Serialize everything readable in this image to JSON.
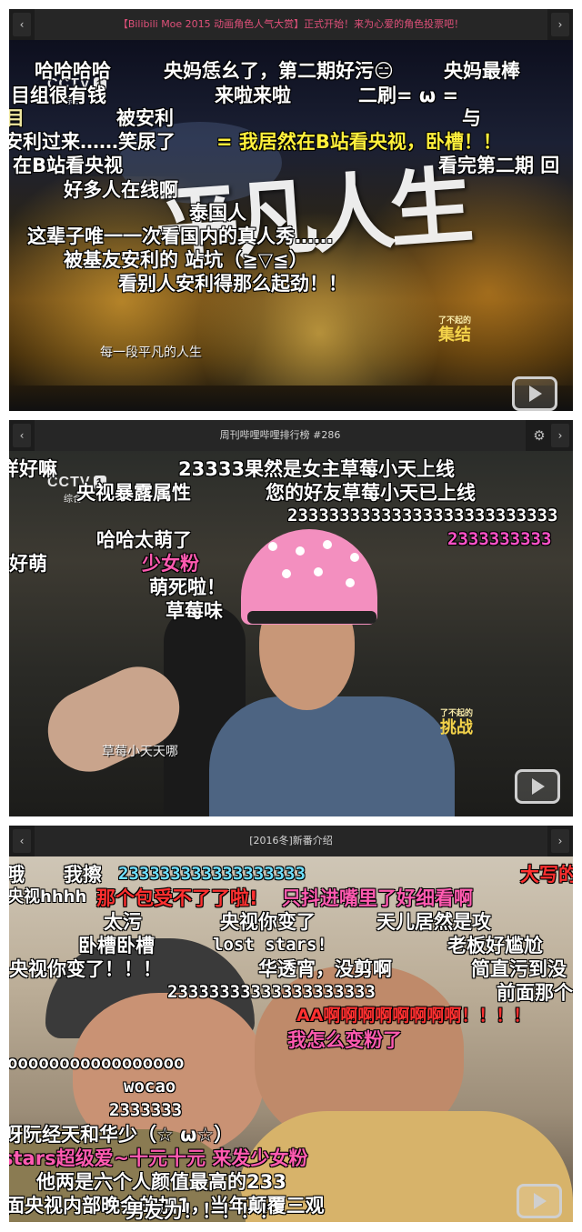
{
  "panels": [
    {
      "title": "【Bilibili Moe 2015 动画角色人气大赏】正式开始！来为心爱的角色投票吧！",
      "nav_prev": "‹",
      "nav_next": "›",
      "channel_logo": "CCTV",
      "channel_num": "1",
      "channel_sub": "综合",
      "show_title": "平凡人生",
      "subtitle": "每一段平凡的人生",
      "program_logo": "集结",
      "program_logo_small": "了不起的",
      "danmaku": [
        "哈哈哈哈",
        "央妈恁幺了，第二期好污😑",
        "央妈最棒",
        "目组很有钱",
        "来啦来啦",
        "二刷= ω =",
        "目",
        "被安利",
        "与",
        "安利过来……笑尿了",
        "= 我居然在B站看央视，卧槽！！",
        "在B站看央视",
        "看完第二期 回",
        "好多人在线啊",
        "泰国人",
        "这辈子唯一一次看国内的真人秀……",
        "被基友安利的 站坑（≧▽≦）",
        "看别人安利得那么起劲！！"
      ]
    },
    {
      "title": "周刊哔哩哔哩排行榜 #286",
      "nav_prev": "‹",
      "nav_next": "›",
      "channel_logo": "CCTV",
      "channel_num": "1",
      "channel_sub": "综合",
      "subtitle": "草莓小天天哪",
      "program_logo": "挑战",
      "program_logo_small": "了不起的",
      "danmaku": [
        "样好嘛",
        "23333果然是女主草莓小天上线",
        "央视暴露属性",
        "您的好友草莓小天已上线",
        "23333333333333333333333333",
        "哈哈太萌了",
        "2333333333",
        "好萌",
        "少女粉",
        "萌死啦！",
        "草莓味"
      ]
    },
    {
      "title": "[2016冬]新番介绍",
      "nav_prev": "‹",
      "nav_next": "›",
      "danmaku": [
        "哦",
        "我擦",
        "233333333333333333",
        "大写的",
        "央视hhhh",
        "那个包受不了了啦!",
        "只抖进嘴里了好细看啊",
        "太污",
        "央视你变了",
        "天儿居然是攻",
        "卧槽卧槽",
        "lost stars!",
        "老板好尴尬",
        "央视你变了！！！",
        "华透宵，没剪啊",
        "简直污到没",
        "23333333333333333333",
        "前面那个",
        "AA啊啊啊啊啊啊啊啊！！！！",
        "我怎么变粉了",
        "ooooooooooooooooo",
        "wocao",
        "2333333",
        "呀阮经天和华少（☆ ω☆）",
        "stars超级爱~十元十元 来发少女粉",
        "他两是六个人颜值最高的233",
        "面央视内部晚会的加1，当年颠覆三观",
        "男友力！！！！！"
      ]
    }
  ],
  "colors": {
    "page_bg": "#ffffff",
    "panel_bg": "#101010",
    "bar_bg": "#262626",
    "title_pink": "#e0507a",
    "danmaku_yellow": "#fff03c",
    "danmaku_magenta": "#ff52c8",
    "danmaku_red": "#ff3030",
    "danmaku_cyan": "#6fe0ff"
  },
  "icons": {
    "prev": "chevron-left-icon",
    "next": "chevron-right-icon",
    "settings": "gear-icon",
    "play": "play-icon"
  }
}
